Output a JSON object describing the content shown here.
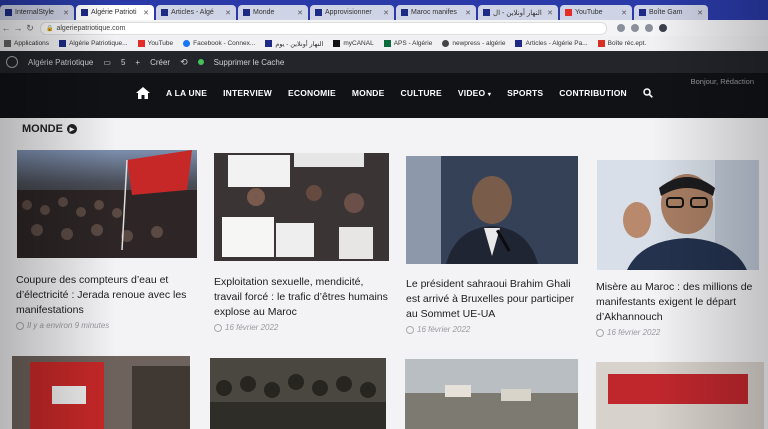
{
  "browser": {
    "tabs": [
      {
        "label": "InternalStyle",
        "active": false
      },
      {
        "label": "Algérie Patrioti",
        "active": true
      },
      {
        "label": "Articles - Algé",
        "active": false
      },
      {
        "label": "Monde",
        "active": false
      },
      {
        "label": "Approvisionner",
        "active": false
      },
      {
        "label": "Maroc manifes",
        "active": false
      },
      {
        "label": "النهار أونلاين - ال",
        "active": false
      },
      {
        "label": "YouTube",
        "active": false
      },
      {
        "label": "Boîte Gam",
        "active": false
      }
    ],
    "url": "algeriepatriotique.com",
    "bookmarks": [
      "Applications",
      "Algérie Patriotique...",
      "YouTube",
      "Facebook - Connex...",
      "النهار أونلاين - يوم",
      "myCANAL",
      "APS - Algérie",
      "newpress - algérie",
      "Articles - Algérie Pa...",
      "Boîte réc.ept."
    ]
  },
  "adminbar": {
    "site": "Algérie Patriotique",
    "comments": "5",
    "new": "Créer",
    "cache": "Supprimer le Cache"
  },
  "nav": {
    "items": [
      "A LA UNE",
      "INTERVIEW",
      "ECONOMIE",
      "MONDE",
      "CULTURE",
      "VIDEO",
      "SPORTS",
      "CONTRIBUTION"
    ],
    "greeting": "Bonjour, Rédaction"
  },
  "section": {
    "title": "MONDE"
  },
  "articles": [
    {
      "title": "Coupure des compteurs d’eau et d’électricité : Jerada renoue avec les manifestations",
      "date": "Il y a environ 9 minutes"
    },
    {
      "title": "Exploitation sexuelle, mendicité, travail forcé : le trafic d’êtres humains explose au Maroc",
      "date": "16 février 2022"
    },
    {
      "title": "Le président sahraoui Brahim Ghali est arrivé à Bruxelles pour participer au Sommet UE-UA",
      "date": "16 février 2022"
    },
    {
      "title": "Misère au Maroc : des millions de manifestants exigent le départ d’Akhannouch",
      "date": "16 février 2022"
    }
  ],
  "colors": {
    "nav_bg": "#101216",
    "admin_bg": "#23252b",
    "tab_strip": "#2a3aa8"
  }
}
